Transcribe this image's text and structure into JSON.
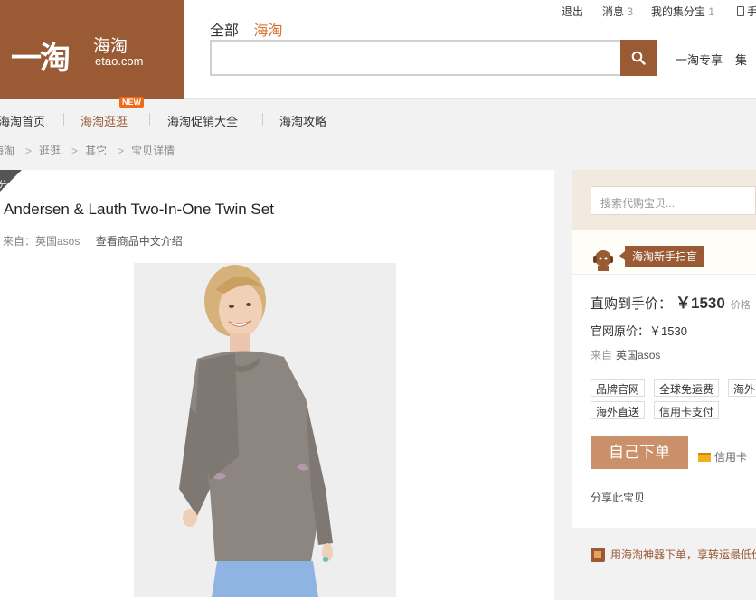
{
  "logo": {
    "mark": "一淘",
    "cn": "海淘",
    "en": "etao.com"
  },
  "topbar": {
    "logout": "退出",
    "messages": "消息",
    "messages_count": "3",
    "my_treasure": "我的集分宝",
    "my_treasure_count": "1",
    "mobile": "手"
  },
  "scope": {
    "all": "全部",
    "haitao": "海淘"
  },
  "search": {
    "placeholder": ""
  },
  "after_search": [
    "一淘专享",
    "集"
  ],
  "nav": {
    "items": [
      "海淘首页",
      "海淘逛逛",
      "海淘促销大全",
      "海淘攻略"
    ],
    "active_index": 1,
    "badge": "NEW"
  },
  "breadcrumb": [
    "海淘",
    "逛逛",
    "其它",
    "宝贝详情"
  ],
  "product": {
    "corner": "分",
    "title": "Andersen & Lauth Two-In-One Twin Set",
    "source": "来自：英国asos",
    "cn_intro": "查看商品中文介绍"
  },
  "sidebar": {
    "search_placeholder": "搜索代购宝贝...",
    "guide": "海淘新手扫盲",
    "price_label": "直购到手价：",
    "price_value": "￥1530",
    "price_more": "价格",
    "orig_price": "官网原价：￥1530",
    "from_label": "来自",
    "from_value": "英国asos",
    "tags": [
      "品牌官网",
      "全球免运费",
      "海外",
      "海外直送",
      "信用卡支付"
    ],
    "buy_label": "自己下单",
    "credit_label": "信用卡",
    "share": "分享此宝贝"
  },
  "promo": "用海淘神器下单，享转运最低价",
  "colors": {
    "brand": "#9a5a34",
    "accent_orange": "#d9702f",
    "buy": "#c9906a"
  }
}
